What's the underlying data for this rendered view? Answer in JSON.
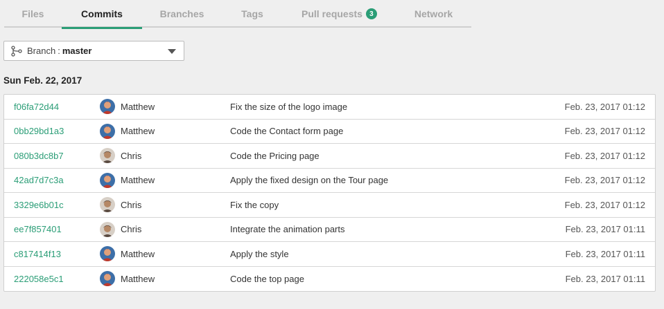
{
  "tabs": [
    {
      "label": "Files"
    },
    {
      "label": "Commits"
    },
    {
      "label": "Branches"
    },
    {
      "label": "Tags"
    },
    {
      "label": "Pull requests",
      "badge": "3"
    },
    {
      "label": "Network"
    }
  ],
  "active_tab": "Commits",
  "branch": {
    "label": "Branch",
    "colon": ":",
    "value": "master"
  },
  "date_heading": "Sun Feb. 22, 2017",
  "colors": {
    "accent": "#2a9d76"
  },
  "commits": [
    {
      "sha": "f06fa72d44",
      "author": "Matthew",
      "message": "Fix the size of the logo image",
      "time": "Feb. 23, 2017 01:12"
    },
    {
      "sha": "0bb29bd1a3",
      "author": "Matthew",
      "message": "Code the Contact form page",
      "time": "Feb. 23, 2017 01:12"
    },
    {
      "sha": "080b3dc8b7",
      "author": "Chris",
      "message": "Code the Pricing page",
      "time": "Feb. 23, 2017 01:12"
    },
    {
      "sha": "42ad7d7c3a",
      "author": "Matthew",
      "message": "Apply the fixed design on the Tour page",
      "time": "Feb. 23, 2017 01:12"
    },
    {
      "sha": "3329e6b01c",
      "author": "Chris",
      "message": "Fix the copy",
      "time": "Feb. 23, 2017 01:12"
    },
    {
      "sha": "ee7f857401",
      "author": "Chris",
      "message": "Integrate the animation parts",
      "time": "Feb. 23, 2017 01:11"
    },
    {
      "sha": "c817414f13",
      "author": "Matthew",
      "message": "Apply the style",
      "time": "Feb. 23, 2017 01:11"
    },
    {
      "sha": "222058e5c1",
      "author": "Matthew",
      "message": "Code the top page",
      "time": "Feb. 23, 2017 01:11"
    }
  ]
}
